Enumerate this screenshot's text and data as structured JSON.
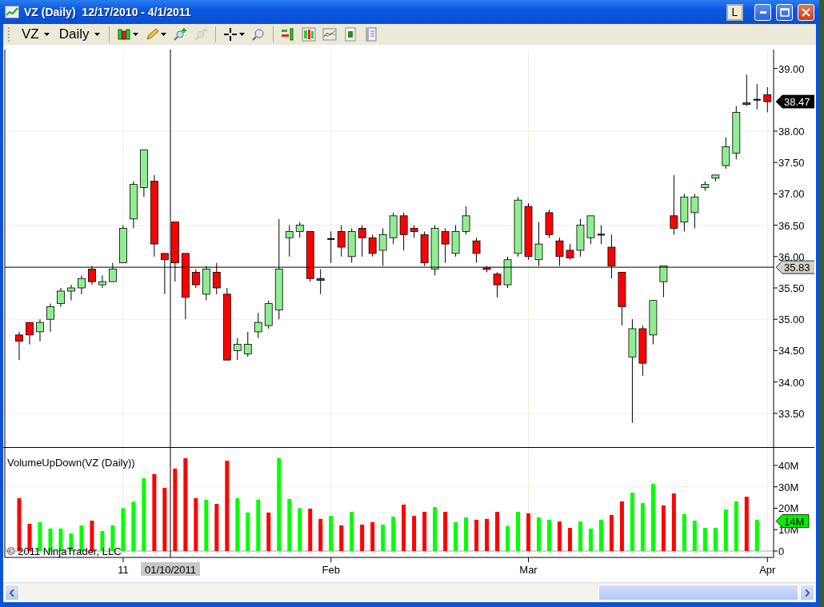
{
  "window": {
    "title": "VZ (Daily)  12/17/2010 - 4/1/2011",
    "layout_button": "L"
  },
  "toolbar": {
    "instrument": "VZ",
    "interval": "Daily",
    "groups": [
      [
        {
          "kind": "candles",
          "dropdown": true,
          "disabled": false
        },
        {
          "kind": "pencil",
          "dropdown": true,
          "disabled": false
        },
        {
          "kind": "zoom-in",
          "dropdown": false,
          "disabled": false
        },
        {
          "kind": "zoom-out",
          "dropdown": false,
          "disabled": true
        }
      ],
      [
        {
          "kind": "crosshair",
          "dropdown": true,
          "disabled": false
        },
        {
          "kind": "magnifier",
          "dropdown": false,
          "disabled": false
        }
      ],
      [
        {
          "kind": "bars",
          "dropdown": false,
          "disabled": false
        },
        {
          "kind": "candle-panel",
          "dropdown": false,
          "disabled": false
        },
        {
          "kind": "line-chart",
          "dropdown": false,
          "disabled": false
        },
        {
          "kind": "dollar",
          "dropdown": false,
          "disabled": false
        },
        {
          "kind": "form",
          "dropdown": false,
          "disabled": false
        }
      ]
    ]
  },
  "price_panel": {
    "last_price": "38.47",
    "chart_data": {
      "type": "candlestick",
      "grid": true,
      "ylim": [
        32.95,
        39.3
      ],
      "ref_lines": [
        {
          "axis": "y",
          "value": 35.83,
          "label": "35.83"
        }
      ],
      "yticks": [
        {
          "value": 33.5,
          "label": "33.50"
        },
        {
          "value": 34,
          "label": "34.00"
        },
        {
          "value": 34.5,
          "label": "34.50"
        },
        {
          "value": 35,
          "label": "35.00"
        },
        {
          "value": 35.5,
          "label": "35.50"
        },
        {
          "value": 36,
          "label": "36.00"
        },
        {
          "value": 36.5,
          "label": "36.50"
        },
        {
          "value": 37,
          "label": "37.00"
        },
        {
          "value": 37.5,
          "label": "37.50"
        },
        {
          "value": 38,
          "label": "38.00"
        },
        {
          "value": 39,
          "label": "39.00"
        }
      ],
      "categories": [
        null,
        null,
        null,
        null,
        null,
        null,
        null,
        null,
        null,
        null,
        null,
        null,
        null,
        null,
        null,
        null,
        null,
        null,
        null,
        null,
        null,
        null,
        null,
        null,
        null,
        null,
        null,
        null,
        null,
        null,
        null,
        null,
        null,
        null,
        null,
        null,
        null,
        null,
        null,
        null,
        null,
        null,
        null,
        null,
        null,
        null,
        null,
        null,
        null,
        null,
        null,
        null,
        null,
        null,
        null,
        null,
        null,
        null,
        null,
        null,
        null,
        null,
        null,
        null,
        null,
        null,
        null,
        null,
        null,
        null,
        null,
        null,
        null
      ],
      "ohlc": [
        [
          34.75,
          34.8,
          34.35,
          34.65
        ],
        [
          34.95,
          34.95,
          34.6,
          34.75
        ],
        [
          34.8,
          35.0,
          34.65,
          34.95
        ],
        [
          35.0,
          35.25,
          34.8,
          35.2
        ],
        [
          35.25,
          35.5,
          35.2,
          35.45
        ],
        [
          35.45,
          35.55,
          35.3,
          35.5
        ],
        [
          35.5,
          35.7,
          35.4,
          35.65
        ],
        [
          35.8,
          35.85,
          35.55,
          35.6
        ],
        [
          35.55,
          35.7,
          35.5,
          35.6
        ],
        [
          35.6,
          35.9,
          35.6,
          35.8
        ],
        [
          35.9,
          36.5,
          35.9,
          36.45
        ],
        [
          36.6,
          37.2,
          36.45,
          37.15
        ],
        [
          37.1,
          37.7,
          36.95,
          37.7
        ],
        [
          37.2,
          37.3,
          36.0,
          36.2
        ],
        [
          36.05,
          36.05,
          35.4,
          35.95
        ],
        [
          36.55,
          36.55,
          35.6,
          35.9
        ],
        [
          36.05,
          36.05,
          35.0,
          35.35
        ],
        [
          35.75,
          35.8,
          35.5,
          35.55
        ],
        [
          35.4,
          35.85,
          35.3,
          35.8
        ],
        [
          35.75,
          35.9,
          35.4,
          35.5
        ],
        [
          35.4,
          35.5,
          34.35,
          34.35
        ],
        [
          34.5,
          34.7,
          34.35,
          34.6
        ],
        [
          34.45,
          34.8,
          34.4,
          34.6
        ],
        [
          34.8,
          35.1,
          34.7,
          34.95
        ],
        [
          34.9,
          35.3,
          34.85,
          35.25
        ],
        [
          35.15,
          36.6,
          35.0,
          35.8
        ],
        [
          36.3,
          36.5,
          36.0,
          36.4
        ],
        [
          36.4,
          36.55,
          36.3,
          36.5
        ],
        [
          36.4,
          36.4,
          35.6,
          35.65
        ],
        [
          35.65,
          35.8,
          35.4,
          35.62
        ],
        [
          36.28,
          36.4,
          35.9,
          36.28
        ],
        [
          36.4,
          36.5,
          36.0,
          36.15
        ],
        [
          36.0,
          36.45,
          35.9,
          36.4
        ],
        [
          36.45,
          36.5,
          36.0,
          36.3
        ],
        [
          36.3,
          36.35,
          36.0,
          36.05
        ],
        [
          36.1,
          36.45,
          35.85,
          36.35
        ],
        [
          36.3,
          36.7,
          36.2,
          36.65
        ],
        [
          36.65,
          36.7,
          36.1,
          36.35
        ],
        [
          36.45,
          36.5,
          36.3,
          36.4
        ],
        [
          36.35,
          36.4,
          35.85,
          35.9
        ],
        [
          35.8,
          36.5,
          35.7,
          36.45
        ],
        [
          36.4,
          36.45,
          35.9,
          36.2
        ],
        [
          36.05,
          36.5,
          36.0,
          36.4
        ],
        [
          36.4,
          36.8,
          36.35,
          36.65
        ],
        [
          36.25,
          36.3,
          35.9,
          36.05
        ],
        [
          35.82,
          35.85,
          35.75,
          35.8
        ],
        [
          35.72,
          35.75,
          35.35,
          35.55
        ],
        [
          35.55,
          36.0,
          35.5,
          35.95
        ],
        [
          36.05,
          36.95,
          36.0,
          36.9
        ],
        [
          36.8,
          36.85,
          35.95,
          36.0
        ],
        [
          35.95,
          36.55,
          35.85,
          36.2
        ],
        [
          36.7,
          36.75,
          36.3,
          36.35
        ],
        [
          36.25,
          36.3,
          35.85,
          36.0
        ],
        [
          36.1,
          36.2,
          35.95,
          35.98
        ],
        [
          36.1,
          36.6,
          36.0,
          36.5
        ],
        [
          36.3,
          36.65,
          36.2,
          36.65
        ],
        [
          36.35,
          36.5,
          36.2,
          36.35
        ],
        [
          36.15,
          36.35,
          35.65,
          35.85
        ],
        [
          35.75,
          35.75,
          34.9,
          35.2
        ],
        [
          34.4,
          35.0,
          33.35,
          34.85
        ],
        [
          34.85,
          34.9,
          34.1,
          34.3
        ],
        [
          34.75,
          35.3,
          34.6,
          35.3
        ],
        [
          35.6,
          35.85,
          35.35,
          35.85
        ],
        [
          36.65,
          37.3,
          36.35,
          36.45
        ],
        [
          36.55,
          37.0,
          36.4,
          36.95
        ],
        [
          36.7,
          37.0,
          36.45,
          36.95
        ],
        [
          37.1,
          37.2,
          37.05,
          37.15
        ],
        [
          37.25,
          37.3,
          37.2,
          37.3
        ],
        [
          37.45,
          37.9,
          37.4,
          37.75
        ],
        [
          37.65,
          38.4,
          37.55,
          38.3
        ],
        [
          38.45,
          38.9,
          38.4,
          38.43
        ],
        [
          38.5,
          38.75,
          38.35,
          38.5
        ],
        [
          38.58,
          38.7,
          38.3,
          38.47
        ]
      ]
    }
  },
  "volume_panel": {
    "title": "VolumeUpDown(VZ (Daily))",
    "copyright": "© 2011 NinjaTrader, LLC",
    "crosshair_date": "01/10/2011",
    "last_volume": "14M",
    "chart_data": {
      "type": "bar",
      "stacked": true,
      "grid": true,
      "ylim": [
        0,
        48.2
      ],
      "yticks": [
        {
          "value": 0,
          "label": "0"
        },
        {
          "value": 10,
          "label": "10M"
        },
        {
          "value": 20,
          "label": "20M"
        },
        {
          "value": 30,
          "label": "30M"
        },
        {
          "value": 40,
          "label": "40M"
        }
      ],
      "categories": [
        null,
        null,
        null,
        null,
        null,
        null,
        null,
        null,
        null,
        null,
        "11",
        null,
        null,
        null,
        null,
        null,
        null,
        null,
        null,
        null,
        null,
        null,
        null,
        null,
        null,
        null,
        null,
        null,
        null,
        null,
        "Feb",
        null,
        null,
        null,
        null,
        null,
        null,
        null,
        null,
        null,
        null,
        null,
        null,
        null,
        null,
        null,
        null,
        null,
        null,
        "Mar",
        null,
        null,
        null,
        null,
        null,
        null,
        null,
        null,
        null,
        null,
        null,
        null,
        null,
        null,
        null,
        null,
        null,
        null,
        null,
        null,
        null,
        null,
        "Apr"
      ],
      "series": [
        {
          "color": "#00ff00",
          "values": [
            null,
            null,
            13.5,
            10.5,
            10.5,
            8.2,
            12,
            null,
            9.3,
            12,
            20,
            23,
            34,
            null,
            null,
            null,
            null,
            null,
            24,
            null,
            null,
            24.7,
            18,
            24,
            null,
            43.4,
            24.3,
            20,
            null,
            null,
            16.4,
            null,
            18.3,
            null,
            null,
            12.3,
            16,
            null,
            null,
            null,
            20.5,
            null,
            13.5,
            15.7,
            null,
            null,
            null,
            11.6,
            18.3,
            null,
            15.7,
            14.6,
            null,
            null,
            13.8,
            10.5,
            14.6,
            null,
            null,
            27.3,
            22.4,
            31.4,
            null,
            null,
            17.2,
            14.2,
            10.8,
            10.8,
            19.4,
            23.2,
            null,
            14.6,
            null
          ]
        },
        {
          "color": "#ff0000",
          "values": [
            24.7,
            12.7,
            null,
            null,
            null,
            null,
            null,
            14.2,
            null,
            null,
            null,
            null,
            null,
            36,
            29.5,
            38.5,
            43.4,
            24.7,
            null,
            22,
            42.2,
            null,
            null,
            null,
            18,
            null,
            null,
            null,
            19.8,
            15,
            null,
            12,
            null,
            12.3,
            13.5,
            null,
            null,
            21.7,
            16.4,
            18.3,
            null,
            18.3,
            null,
            null,
            14.6,
            15,
            18.3,
            null,
            null,
            17.6,
            null,
            null,
            13.8,
            10.8,
            null,
            null,
            null,
            16.8,
            23.2,
            null,
            null,
            null,
            21.3,
            26.9,
            null,
            null,
            null,
            null,
            null,
            null,
            25.4,
            null,
            null
          ]
        }
      ]
    }
  }
}
